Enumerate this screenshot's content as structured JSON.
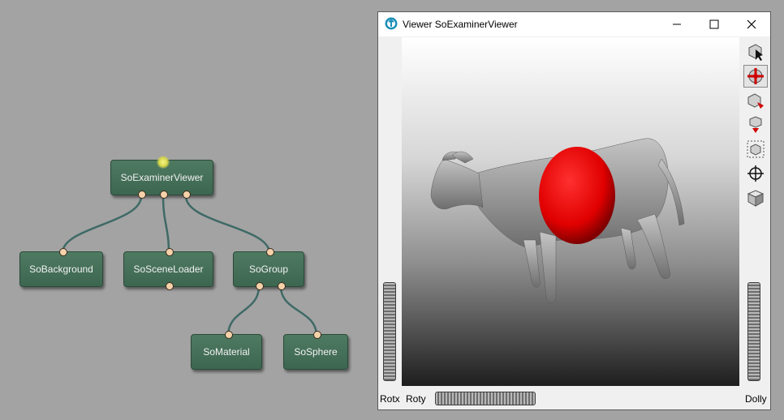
{
  "graph": {
    "nodes": {
      "examiner": "SoExaminerViewer",
      "background": "SoBackground",
      "scene_loader": "SoSceneLoader",
      "group": "SoGroup",
      "material": "SoMaterial",
      "sphere": "SoSphere"
    }
  },
  "viewer": {
    "title": "Viewer SoExaminerViewer",
    "labels": {
      "rotx": "Rotx",
      "roty": "Roty",
      "dolly": "Dolly"
    },
    "toolbar": [
      "pick-icon",
      "view-mode-icon",
      "home-icon",
      "set-home-icon",
      "view-all-icon",
      "seek-icon",
      "projection-icon"
    ]
  },
  "colors": {
    "node_fill": "#476f59",
    "port_fill": "#f6d2aa",
    "wire": "#3f6a66",
    "sphere": "#ee0000",
    "model": "#9a9a9a"
  }
}
